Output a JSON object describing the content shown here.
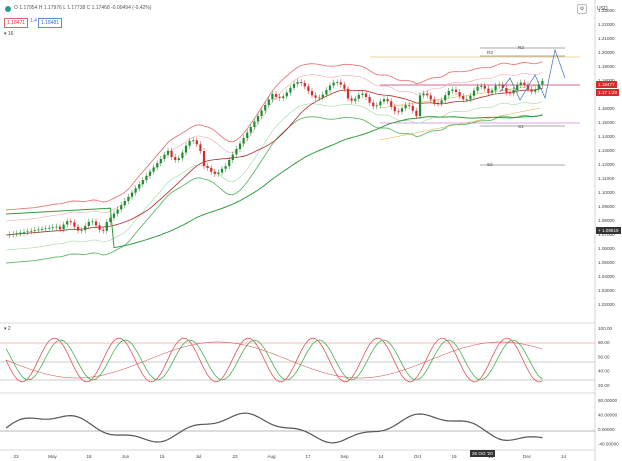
{
  "header": {
    "ohlc_text": "O 1.17954 H 1.17976 L 1.17738 C 1.17468 -0.00494 (-0.42%)",
    "indicator_main": "16",
    "price_sell": "1.18471",
    "price_size": "1.4",
    "price_buy": "1.18481",
    "currency": "USD"
  },
  "price_axis": {
    "ticks": [
      "1.23000",
      "1.22000",
      "1.21000",
      "1.20000",
      "1.19000",
      "1.18000",
      "1.17000",
      "1.16000",
      "1.15000",
      "1.14000",
      "1.13000",
      "1.12000",
      "1.11000",
      "1.10000",
      "1.09000",
      "1.08000",
      "1.07000",
      "1.06000",
      "1.05000",
      "1.04000",
      "1.03000",
      "1.02000"
    ],
    "current_tag": "1.18477",
    "current_tag2": "1.17 1:20",
    "crosshair_tag": "1.08819"
  },
  "rsi_axis": {
    "ticks": [
      "100.00",
      "80.00",
      "60.00",
      "40.00",
      "20.00"
    ],
    "label": "2"
  },
  "macd_axis": {
    "ticks": [
      "80.00000",
      "40.00000",
      "0.00000",
      "-40.00000"
    ]
  },
  "time_axis": {
    "labels": [
      "23",
      "May",
      "18",
      "Jun",
      "15",
      "Jul",
      "23",
      "Aug",
      "17",
      "Sep",
      "14",
      "Oct",
      "19",
      "16",
      "Dec",
      "14"
    ],
    "crosshair": "26 Oct '20"
  },
  "fib_labels": {
    "r3": "R3",
    "r2": "R2",
    "s1": "S1",
    "s2": "S2"
  },
  "colors": {
    "up": "#1e8c2e",
    "down": "#d62b2b",
    "ma": "#2f9e3f",
    "band_up": "#e87a7a",
    "band_low": "#5fba6a"
  }
}
